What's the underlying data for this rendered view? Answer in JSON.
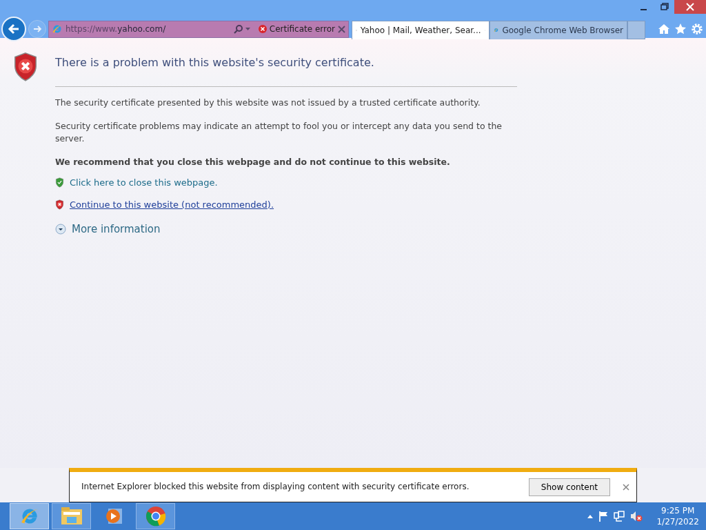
{
  "address_bar": {
    "url_prefix": "https://www.",
    "url_domain": "yahoo.com/",
    "certificate_error": "Certificate error"
  },
  "tabs": [
    {
      "label": "Yahoo | Mail, Weather, Sear...",
      "selected": true
    },
    {
      "label": "Google Chrome Web Browser",
      "selected": false
    }
  ],
  "page": {
    "title": "There is a problem with this website's security certificate.",
    "paragraphs": [
      "The security certificate presented by this website was not issued by a trusted certificate authority.",
      "Security certificate problems may indicate an attempt to fool you or intercept any data you send to the server."
    ],
    "recommendation": "We recommend that you close this webpage and do not continue to this website.",
    "links": [
      {
        "kind": "safe",
        "label": "Click here to close this webpage."
      },
      {
        "kind": "danger",
        "label": "Continue to this website (not recommended)."
      }
    ],
    "more_info": "More information"
  },
  "notification": {
    "message": "Internet Explorer blocked this website from displaying content with security certificate errors.",
    "button": "Show content"
  },
  "taskbar": {
    "apps": [
      {
        "kind": "ie",
        "selected": true,
        "running": true
      },
      {
        "kind": "folder",
        "selected": false,
        "running": true
      },
      {
        "kind": "media",
        "selected": false,
        "running": false
      },
      {
        "kind": "chrome",
        "selected": false,
        "running": true
      }
    ],
    "time": "9:25 PM",
    "date": "1/27/2022"
  }
}
